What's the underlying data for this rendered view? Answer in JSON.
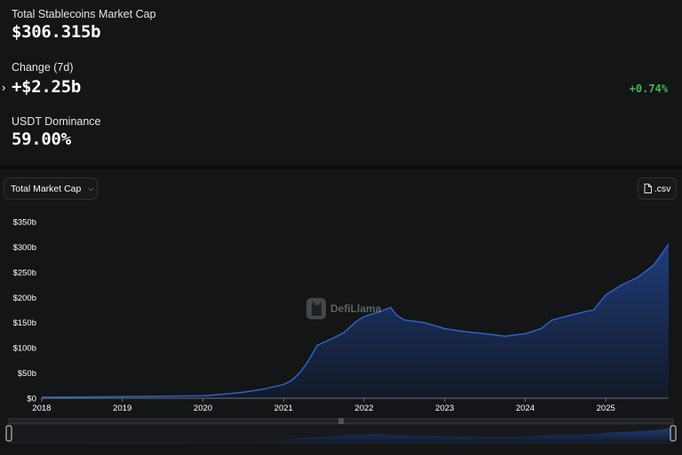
{
  "stats": {
    "total_label": "Total Stablecoins Market Cap",
    "total_value": "$306.315b",
    "change_label": "Change (7d)",
    "change_value": "+$2.25b",
    "change_pct": "+0.74%",
    "dominance_label": "USDT Dominance",
    "dominance_value": "59.00%"
  },
  "controls": {
    "metric_select": "Total Market Cap",
    "csv_label": ".csv"
  },
  "watermark": "DefiLlama",
  "colors": {
    "accent_positive": "#3fb950",
    "series_line": "#2f62c8",
    "area_top": "#1f3f80",
    "area_bottom": "#131a2a"
  },
  "chart_data": {
    "type": "area",
    "title": "",
    "xlabel": "",
    "ylabel": "",
    "x_ticks": [
      "2018",
      "2019",
      "2020",
      "2021",
      "2022",
      "2023",
      "2024",
      "2025"
    ],
    "y_ticks": [
      "$0",
      "$50b",
      "$100b",
      "$150b",
      "$200b",
      "$250b",
      "$300b",
      "$350b"
    ],
    "ylim": [
      0,
      350
    ],
    "xlim": [
      2018.0,
      2025.78
    ],
    "grid": false,
    "series": [
      {
        "x": [
          2018.0,
          2018.5,
          2019.0,
          2019.5,
          2020.0,
          2020.25,
          2020.5,
          2020.75,
          2021.0,
          2021.1,
          2021.2,
          2021.3,
          2021.42,
          2021.6,
          2021.75,
          2021.9,
          2022.0,
          2022.2,
          2022.33,
          2022.4,
          2022.5,
          2022.75,
          2023.0,
          2023.25,
          2023.5,
          2023.75,
          2024.0,
          2024.2,
          2024.33,
          2024.5,
          2024.75,
          2024.85,
          2025.0,
          2025.2,
          2025.4,
          2025.6,
          2025.78
        ],
        "values": [
          2,
          2.5,
          3,
          4,
          5,
          8,
          12,
          18,
          27,
          35,
          50,
          72,
          105,
          118,
          130,
          152,
          162,
          172,
          180,
          165,
          155,
          150,
          138,
          132,
          128,
          123,
          128,
          138,
          155,
          162,
          172,
          175,
          205,
          225,
          240,
          265,
          306
        ]
      }
    ]
  }
}
